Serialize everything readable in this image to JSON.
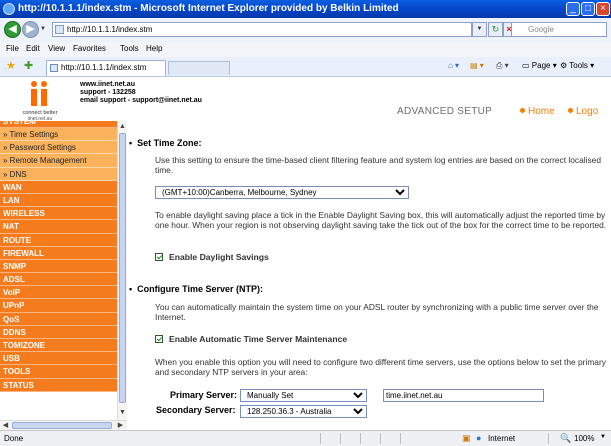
{
  "window": {
    "title": "http://10.1.1.1/index.stm - Microsoft Internet Explorer provided by Belkin Limited",
    "url": "http://10.1.1.1/index.stm",
    "search_placeholder": "Google",
    "tab_title": "http://10.1.1.1/index.stm"
  },
  "menubar": [
    "File",
    "Edit",
    "View",
    "Favorites",
    "Tools",
    "Help"
  ],
  "toolbar": {
    "page": "Page",
    "tools": "Tools"
  },
  "header": {
    "tagline": "connect better",
    "logo_site": "iinet.net.au",
    "line1": "www.iinet.net.au",
    "line2": "support - 132258",
    "line3": "email support - support@iinet.net.au",
    "section": "ADVANCED SETUP",
    "home": "Home",
    "logout": "Logo"
  },
  "sidebar": {
    "system": "SYSTEM",
    "system_items": [
      "» Time Settings",
      "» Password Settings",
      "» Remote Management",
      "» DNS"
    ],
    "sections": [
      "WAN",
      "LAN",
      "WIRELESS",
      "NAT",
      "ROUTE",
      "FIREWALL",
      "SNMP",
      "ADSL",
      "VoIP",
      "UPnP",
      "QoS",
      "DDNS",
      "TOMIZONE",
      "USB",
      "TOOLS",
      "STATUS"
    ]
  },
  "main": {
    "tz_heading": "Set Time Zone:",
    "tz_desc": "Use this setting to ensure the time-based client filtering feature and system log entries are based on the correct localised time.",
    "tz_selected": "(GMT+10:00)Canberra, Melbourne, Sydney",
    "dst_desc": "To enable daylight saving place a tick in the Enable Daylight Saving box, this will automatically adjust the reported time by one hour. When your region is not observing daylight saving take the tick out of the box for the correct time to be reported.",
    "dst_label": "Enable Daylight Savings",
    "ntp_heading": "Configure Time Server (NTP):",
    "ntp_desc": "You can automatically maintain the system time on your ADSL router by synchronizing with a public time server over the Internet.",
    "ntp_label": "Enable Automatic Time Server Maintenance",
    "servers_desc": "When you enable this option you will need to configure two different time servers, use the options below to set the primary and secondary NTP servers in your area:",
    "primary_label": "Primary Server:",
    "primary_selected": "Manually Set",
    "primary_value": "time.iinet.net.au",
    "secondary_label": "Secondary Server:",
    "secondary_selected": "128.250.36.3 - Australia"
  },
  "status": {
    "left": "Done",
    "zone": "Internet",
    "zoom": "100%"
  }
}
